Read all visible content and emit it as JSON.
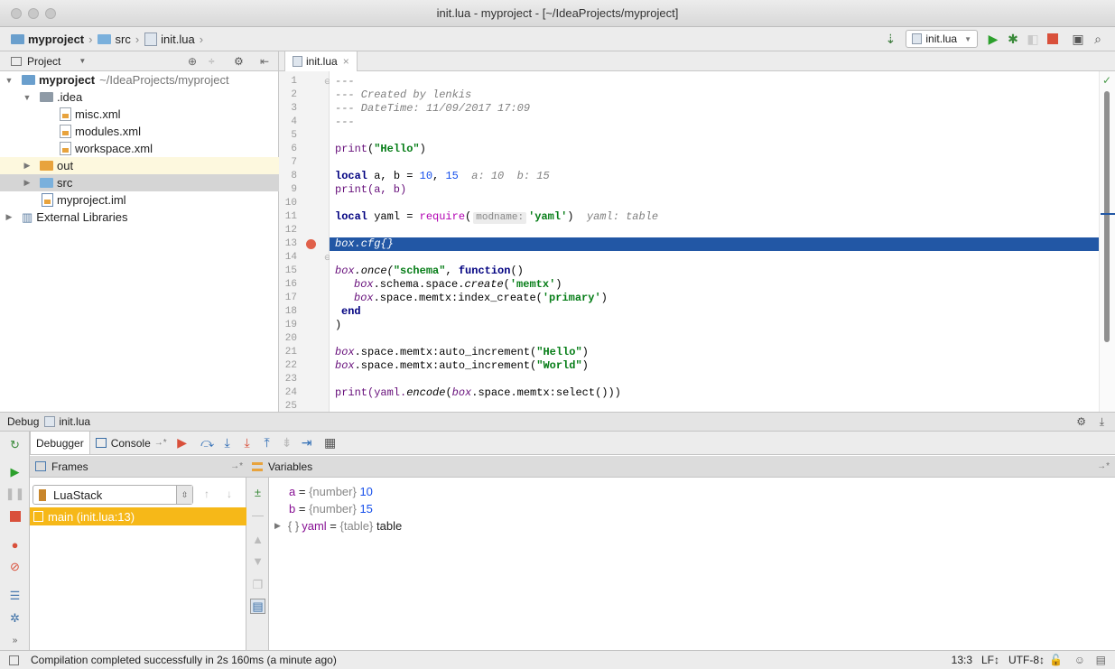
{
  "window": {
    "title": "init.lua - myproject - [~/IdeaProjects/myproject]"
  },
  "navbar": {
    "crumbs": [
      "myproject",
      "src",
      "init.lua"
    ],
    "run_config": "init.lua"
  },
  "project_panel": {
    "title": "Project",
    "tree": [
      {
        "label": "myproject",
        "path": "~/IdeaProjects/myproject"
      },
      {
        "label": ".idea"
      },
      {
        "label": "misc.xml"
      },
      {
        "label": "modules.xml"
      },
      {
        "label": "workspace.xml"
      },
      {
        "label": "out"
      },
      {
        "label": "src"
      },
      {
        "label": "myproject.iml"
      },
      {
        "label": "External Libraries"
      }
    ]
  },
  "editor": {
    "tab": "init.lua",
    "line_numbers": [
      "1",
      "2",
      "3",
      "4",
      "5",
      "6",
      "7",
      "8",
      "9",
      "10",
      "11",
      "12",
      "13",
      "14",
      "15",
      "16",
      "17",
      "18",
      "19",
      "20",
      "21",
      "22",
      "23",
      "24",
      "25"
    ],
    "code": {
      "l1": "---",
      "l2": "--- Created by lenkis",
      "l3": "--- DateTime: 11/09/2017 17:09",
      "l4": "---",
      "l6_fn": "print",
      "l6_str": "\"Hello\"",
      "l8_kw": "local",
      "l8_vars": " a, b = ",
      "l8_n1": "10",
      "l8_n2": "15",
      "l8_hint": "a: 10  b: 15",
      "l9": "print(a, b)",
      "l11_kw": "local",
      "l11_mid": " yaml = ",
      "l11_fn": "require",
      "l11_param": "modname:",
      "l11_str": "'yaml'",
      "l11_hint": "yaml: table",
      "l13": "box.cfg{}",
      "l15_a": "box",
      "l15_b": ".once(",
      "l15_str": "\"schema\"",
      "l15_kw": "function",
      "l16_a": "box",
      "l16_b": ".schema.space.",
      "l16_c": "create",
      "l16_str": "'memtx'",
      "l17_a": "box",
      "l17_b": ".space.memtx:index_create(",
      "l17_str": "'primary'",
      "l18": "end",
      "l19": ")",
      "l21_a": "box",
      "l21_b": ".space.memtx:auto_increment(",
      "l21_str": "\"Hello\"",
      "l22_a": "box",
      "l22_b": ".space.memtx:auto_increment(",
      "l22_str": "\"World\"",
      "l24_a": "print(yaml.",
      "l24_b": "encode",
      "l24_c": "(",
      "l24_d": "box",
      "l24_e": ".space.memtx:select()))"
    }
  },
  "debug": {
    "header": "Debug",
    "config": "init.lua",
    "tabs": [
      "Debugger",
      "Console"
    ],
    "frames_title": "Frames",
    "variables_title": "Variables",
    "thread": "LuaStack",
    "frame": "main (init.lua:13)",
    "variables": [
      {
        "name": "a",
        "type": "{number}",
        "value": "10"
      },
      {
        "name": "b",
        "type": "{number}",
        "value": "15"
      },
      {
        "name": "yaml",
        "type": "{table}",
        "value": "table"
      }
    ]
  },
  "status": {
    "message": "Compilation completed successfully in 2s 160ms (a minute ago)",
    "position": "13:3",
    "line_sep": "LF↕",
    "encoding": "UTF-8↕"
  },
  "colors": {
    "highlight": "#2257a5",
    "frame_selected": "#f6b818",
    "breakpoint": "#e0604a"
  }
}
